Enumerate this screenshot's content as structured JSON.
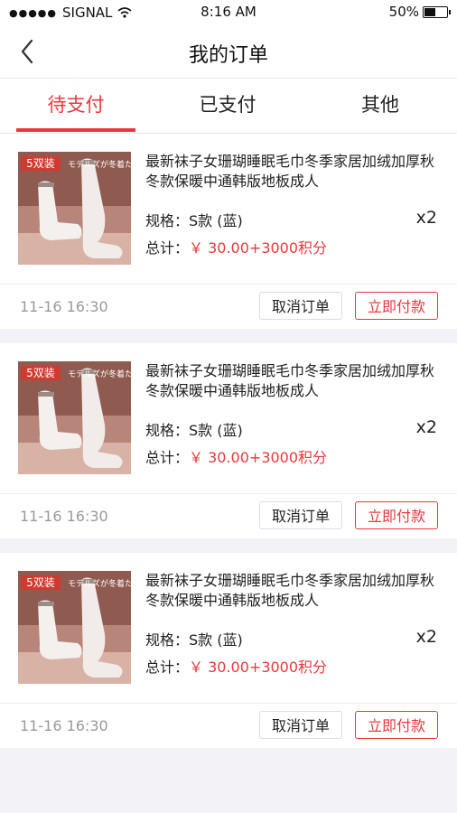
{
  "status_bar": {
    "carrier": "SIGNAL",
    "time": "8:16 AM",
    "battery": "50%",
    "battery_level": 0.5
  },
  "header": {
    "title": "我的订单"
  },
  "tabs": [
    {
      "label": "待支付"
    },
    {
      "label": "已支付"
    },
    {
      "label": "其他"
    }
  ],
  "colors": {
    "accent": "#e8383d"
  },
  "orders": [
    {
      "title": "最新袜子女珊瑚睡眠毛巾冬季家居加绒加厚秋冬款保暖中通韩版地板成人",
      "spec": "规格：S款 (蓝)",
      "qty": "x2",
      "total_label": "总计：",
      "price": "￥ 30.00+3000积分",
      "time": "11-16 16:30",
      "cancel_label": "取消订单",
      "pay_label": "立即付款",
      "badge": "5双装",
      "caption": "モデルズが冬着たいもの!"
    },
    {
      "title": "最新袜子女珊瑚睡眠毛巾冬季家居加绒加厚秋冬款保暖中通韩版地板成人",
      "spec": "规格：S款 (蓝)",
      "qty": "x2",
      "total_label": "总计：",
      "price": "￥ 30.00+3000积分",
      "time": "11-16 16:30",
      "cancel_label": "取消订单",
      "pay_label": "立即付款",
      "badge": "5双装",
      "caption": "モデルズが冬着たいもの!"
    },
    {
      "title": "最新袜子女珊瑚睡眠毛巾冬季家居加绒加厚秋冬款保暖中通韩版地板成人",
      "spec": "规格：S款 (蓝)",
      "qty": "x2",
      "total_label": "总计：",
      "price": "￥ 30.00+3000积分",
      "time": "11-16 16:30",
      "cancel_label": "取消订单",
      "pay_label": "立即付款",
      "badge": "5双装",
      "caption": "モデルズが冬着たいもの!"
    }
  ]
}
